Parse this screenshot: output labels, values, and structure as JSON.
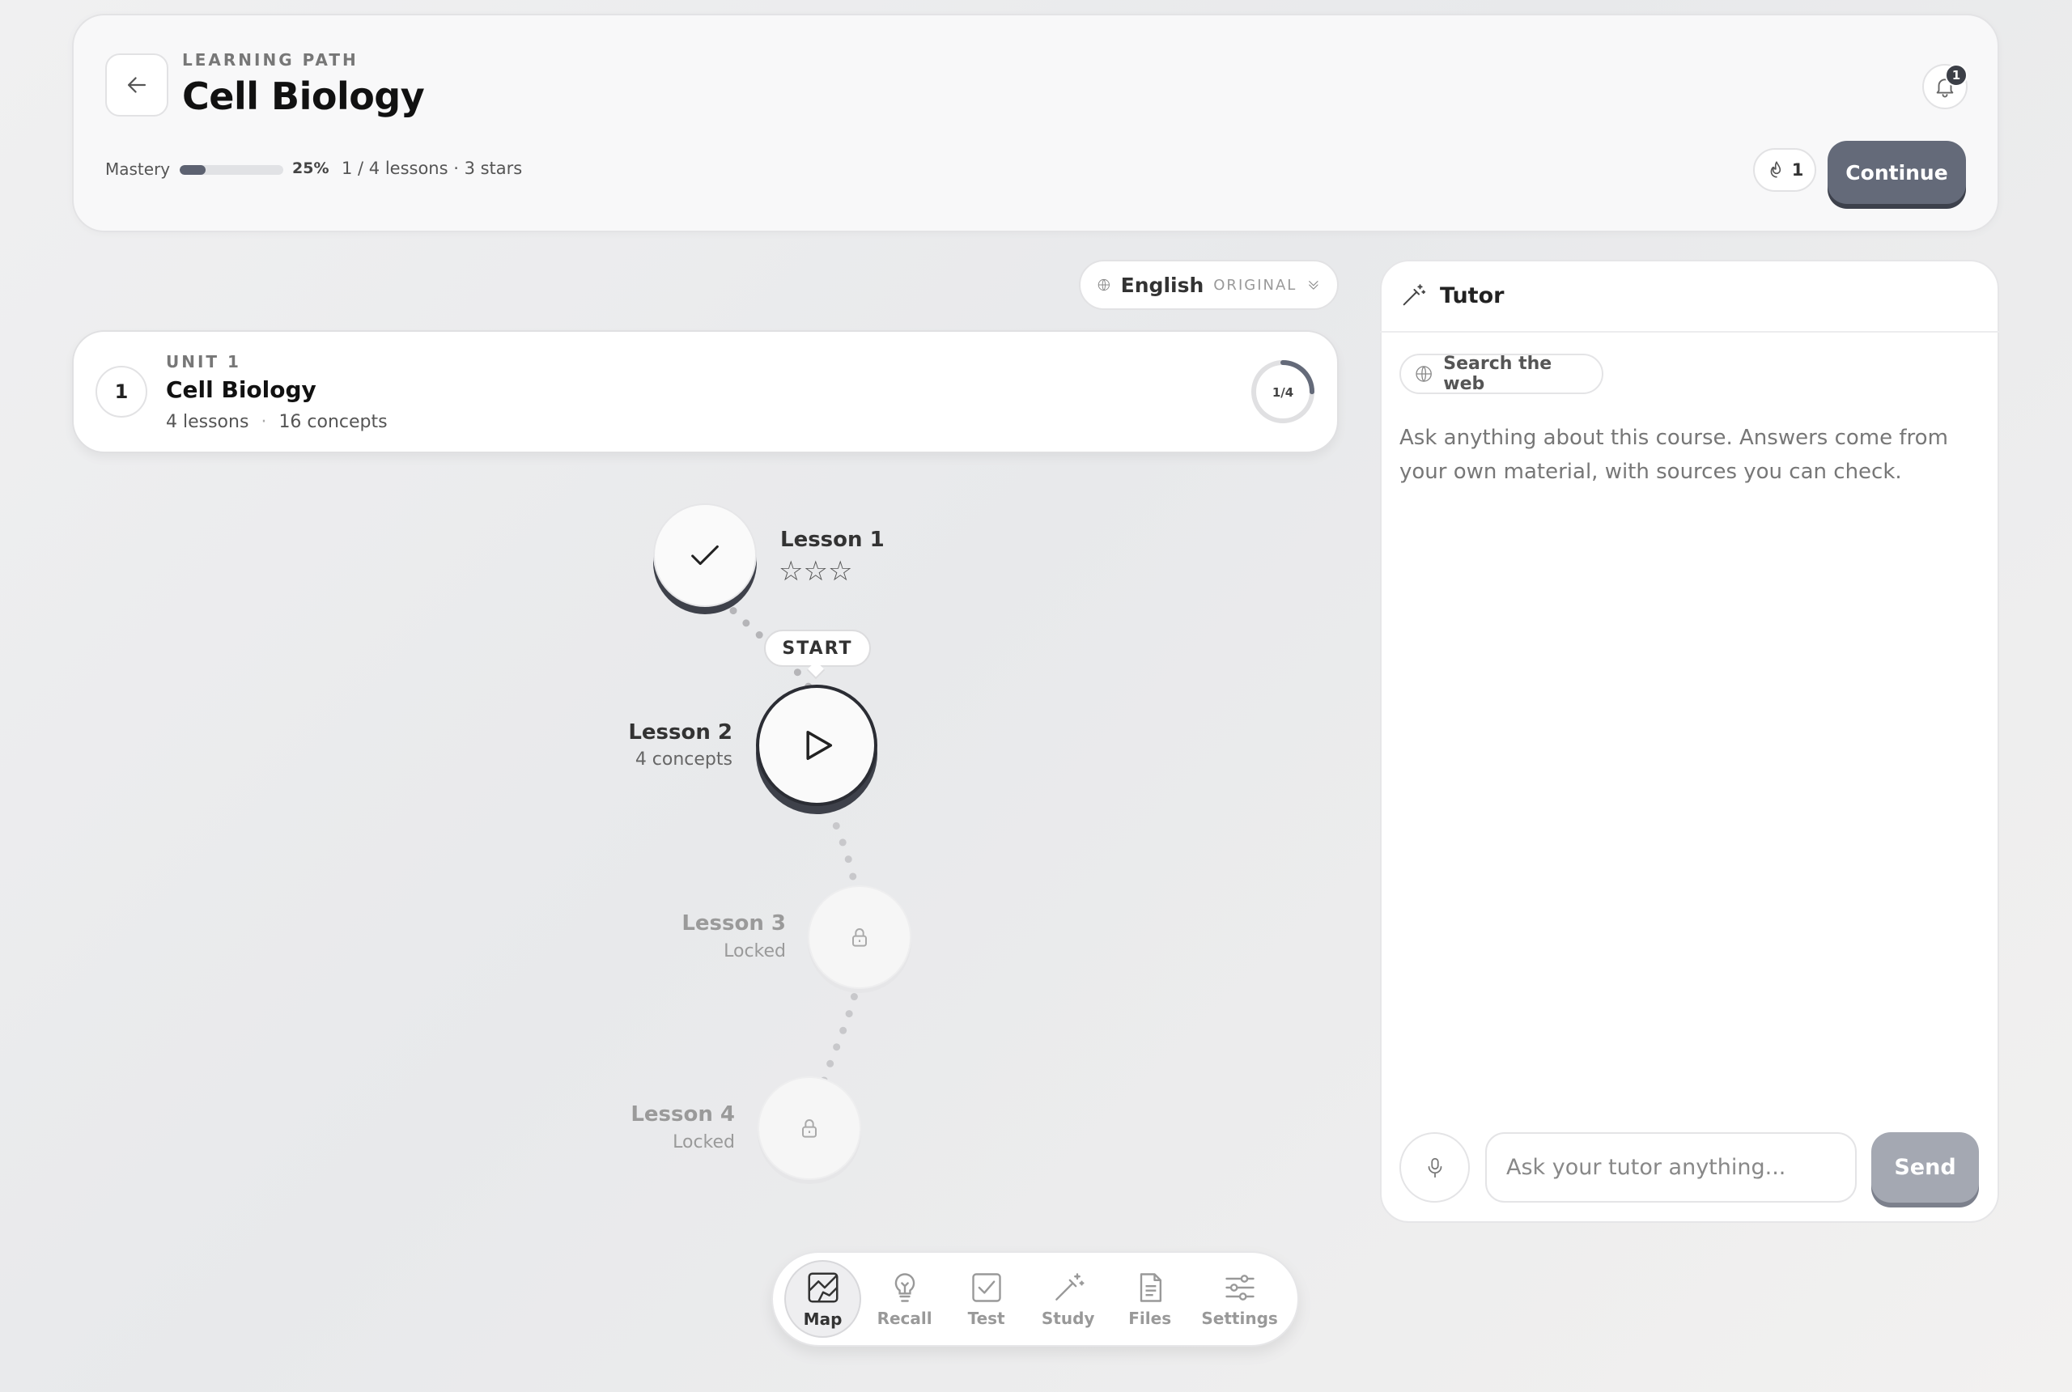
{
  "header": {
    "eyebrow": "LEARNING PATH",
    "title": "Cell Biology",
    "notifications_count": "1",
    "mastery_label": "Mastery",
    "mastery_percent_text": "25%",
    "mastery_fraction": 0.25,
    "lessons_meta": "1 / 4 lessons · 3 stars",
    "streak_count": "1",
    "continue_label": "Continue"
  },
  "language": {
    "name": "English",
    "tag": "ORIGINAL"
  },
  "unit": {
    "number": "1",
    "eyebrow": "UNIT 1",
    "title": "Cell Biology",
    "lessons": "4 lessons",
    "separator": "·",
    "concepts": "16 concepts",
    "progress_text": "1/4",
    "progress_fraction": 0.25
  },
  "path": {
    "start_label": "START",
    "lessons": [
      {
        "title": "Lesson 1",
        "stars": "☆☆☆",
        "state": "done"
      },
      {
        "title": "Lesson 2",
        "subtitle": "4 concepts",
        "state": "current"
      },
      {
        "title": "Lesson 3",
        "subtitle": "Locked",
        "state": "locked"
      },
      {
        "title": "Lesson 4",
        "subtitle": "Locked",
        "state": "locked"
      }
    ]
  },
  "tutor": {
    "title": "Tutor",
    "search_web_label": "Search the web",
    "intro": "Ask anything about this course. Answers come from your own material, with sources you can check.",
    "input_placeholder": "Ask your tutor anything...",
    "send_label": "Send"
  },
  "nav": {
    "items": [
      {
        "label": "Map",
        "icon": "map-icon",
        "active": true
      },
      {
        "label": "Recall",
        "icon": "lightbulb-icon"
      },
      {
        "label": "Test",
        "icon": "checkbox-icon"
      },
      {
        "label": "Study",
        "icon": "magic-wand-icon"
      },
      {
        "label": "Files",
        "icon": "file-icon"
      },
      {
        "label": "Settings",
        "icon": "sliders-icon"
      }
    ]
  },
  "colors": {
    "accent": "#646a79",
    "accent_shadow": "#3d414c",
    "send_disabled": "#a4a8b2"
  }
}
